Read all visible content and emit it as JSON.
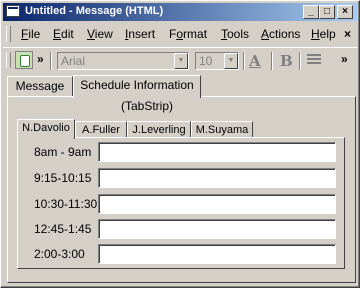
{
  "window": {
    "title": "Untitled - Message (HTML)",
    "controls": {
      "minimize": "_",
      "maximize": "□",
      "close": "×"
    }
  },
  "menubar": {
    "items": [
      {
        "underline": "F",
        "rest": "ile"
      },
      {
        "underline": "E",
        "rest": "dit"
      },
      {
        "underline": "V",
        "rest": "iew"
      },
      {
        "underline": "I",
        "rest": "nsert"
      },
      {
        "prefix": "F",
        "underline": "o",
        "rest": "rmat"
      },
      {
        "underline": "T",
        "rest": "ools"
      },
      {
        "underline": "A",
        "rest": "ctions"
      },
      {
        "underline": "H",
        "rest": "elp"
      }
    ],
    "close_glyph": "×"
  },
  "toolbar": {
    "more_glyph": "»",
    "font_name": "Arial",
    "font_size": "10",
    "font_color_glyph": "A",
    "bold_glyph": "B",
    "icons": [
      "form-design-icon",
      "font-color-icon",
      "bold-icon",
      "bullets-icon"
    ]
  },
  "form": {
    "outer_tabs": [
      "Message",
      "Schedule Information"
    ],
    "tabstrip_label": "(TabStrip)",
    "inner_tabs": [
      "N.Davolio",
      "A.Fuller",
      "J.Leverling",
      "M.Suyama"
    ],
    "slots": [
      "8am - 9am",
      "9:15-10:15",
      "10:30-11:30",
      "12:45-1:45",
      "2:00-3:00"
    ]
  }
}
